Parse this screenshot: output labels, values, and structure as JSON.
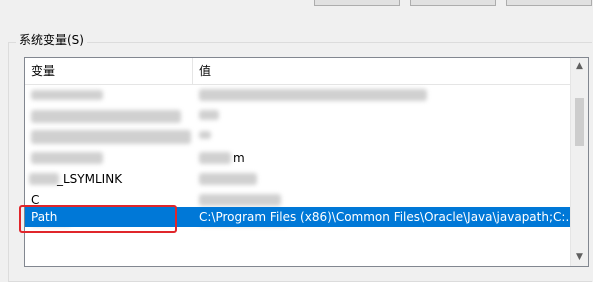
{
  "group": {
    "label": "系统变量(S)"
  },
  "table": {
    "columns": {
      "name": "变量",
      "value": "值"
    },
    "rows": [
      {
        "name": "",
        "value": ""
      },
      {
        "name": "",
        "value": ""
      },
      {
        "name": "",
        "value": ""
      },
      {
        "name": "",
        "value": "m"
      },
      {
        "name": "_LSYMLINK",
        "value": ""
      },
      {
        "name": "C",
        "value": ""
      },
      {
        "name": "Path",
        "value": "C:\\Program Files (x86)\\Common Files\\Oracle\\Java\\javapath;C:..."
      }
    ],
    "selected_row": "Path"
  },
  "colors": {
    "selection": "#0078d7",
    "highlight_box": "#e0262b"
  },
  "icons": [
    "scroll-up-icon",
    "scroll-down-icon"
  ]
}
